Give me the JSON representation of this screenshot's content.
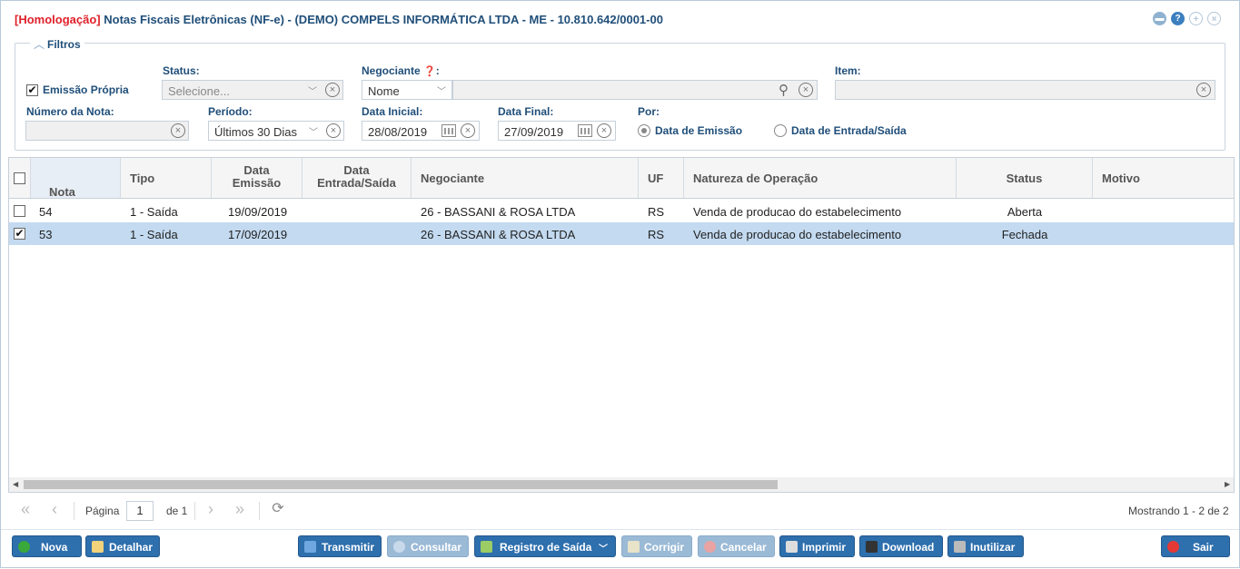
{
  "title": {
    "env": "[Homologação]",
    "text": "Notas Fiscais Eletrônicas (NF-e) - (DEMO) COMPELS INFORMÁTICA LTDA - ME - 10.810.642/0001-00"
  },
  "filters": {
    "legend": "Filtros",
    "emissao_propria": "Emissão Própria",
    "status_label": "Status:",
    "status_placeholder": "Selecione...",
    "negociante_label": "Negociante",
    "negociante_type": "Nome",
    "negociante_value": "",
    "item_label": "Item:",
    "item_value": "",
    "numero_label": "Número da Nota:",
    "numero_value": "",
    "periodo_label": "Período:",
    "periodo_value": "Últimos 30 Dias",
    "data_inicial_label": "Data Inicial:",
    "data_inicial": "28/08/2019",
    "data_final_label": "Data Final:",
    "data_final": "27/09/2019",
    "por_label": "Por:",
    "por_emissao": "Data de Emissão",
    "por_entrada": "Data de Entrada/Saída"
  },
  "table": {
    "headers": [
      "Nota",
      "Tipo",
      "Data Emissão",
      "Data Entrada/Saída",
      "Negociante",
      "UF",
      "Natureza de Operação",
      "Status",
      "Motivo"
    ],
    "rows": [
      {
        "nota": "54",
        "tipo": "1 - Saída",
        "emissao": "19/09/2019",
        "entrada": "",
        "negociante": "26 - BASSANI & ROSA LTDA",
        "uf": "RS",
        "natureza": "Venda de producao do estabelecimento",
        "status": "Aberta",
        "motivo": "",
        "checked": false
      },
      {
        "nota": "53",
        "tipo": "1 - Saída",
        "emissao": "17/09/2019",
        "entrada": "",
        "negociante": "26 - BASSANI & ROSA LTDA",
        "uf": "RS",
        "natureza": "Venda de producao do estabelecimento",
        "status": "Fechada",
        "motivo": "",
        "checked": true
      }
    ]
  },
  "pager": {
    "page_label": "Página",
    "page": "1",
    "of": "de 1",
    "showing": "Mostrando 1 - 2 de 2"
  },
  "buttons": {
    "nova": "Nova",
    "detalhar": "Detalhar",
    "transmitir": "Transmitir",
    "consultar": "Consultar",
    "registro": "Registro de Saída",
    "corrigir": "Corrigir",
    "cancelar": "Cancelar",
    "imprimir": "Imprimir",
    "download": "Download",
    "inutilizar": "Inutilizar",
    "sair": "Sair"
  }
}
